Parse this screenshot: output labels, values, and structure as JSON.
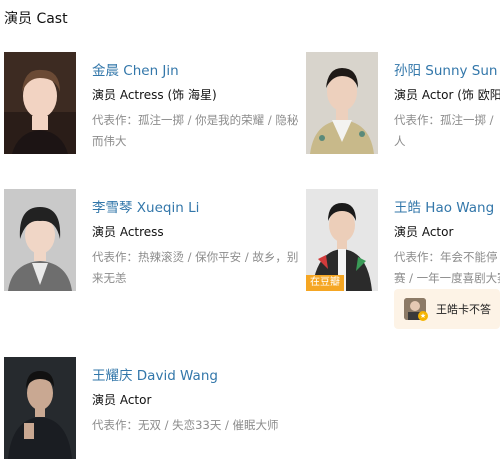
{
  "section": {
    "title": "演员 Cast"
  },
  "cast": [
    {
      "name": "金晨 Chen Jin",
      "role": "演员 Actress (饰 海星)",
      "works_label": "代表作：",
      "works_line1": "孤注一掷 / 你是我的荣耀 / 隐秘",
      "works_line2": "而伟大"
    },
    {
      "name": "孙阳 Sunny Sun",
      "role": "演员 Actor (饰 欧阳)",
      "works_label": "代表作：",
      "works_line1": "孤注一掷 /",
      "works_line2": "人"
    },
    {
      "name": "李雪琴 Xueqin Li",
      "role": "演员 Actress",
      "works_label": "代表作：",
      "works_line1": "热辣滚烫 / 保你平安 / 故乡，别",
      "works_line2": "来无恙"
    },
    {
      "name": "王皓 Hao Wang",
      "role": "演员 Actor",
      "works_label": "代表作：",
      "works_line1": "年会不能停",
      "works_line2": "赛 / 一年一度喜剧大赛",
      "badge": "在豆瓣",
      "fan_card": "王皓卡不答"
    },
    {
      "name": "王耀庆 David Wang",
      "role": "演员 Actor",
      "works_label": "代表作：",
      "works_line1": "无双 / 失恋33天 / 催眠大师",
      "works_line2": ""
    }
  ],
  "colors": {
    "link": "#3377aa",
    "muted": "#8c8c8c",
    "badge": "#f5a623",
    "fan_bg": "#fdf3e6"
  }
}
